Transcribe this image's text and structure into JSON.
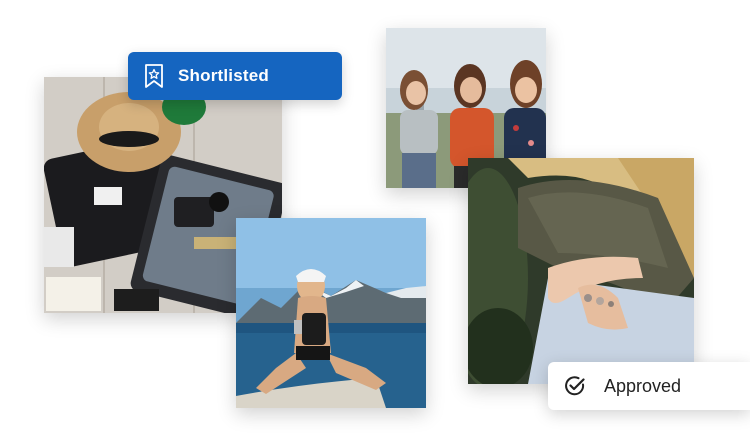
{
  "badges": {
    "shortlisted": {
      "label": "Shortlisted",
      "icon": "bookmark-star-icon",
      "color": "#1565c0"
    },
    "approved": {
      "label": "Approved",
      "icon": "check-circle-icon",
      "color": "#ffffff"
    }
  },
  "photos": [
    {
      "name": "photo-suitcase",
      "subject": "open suitcase with sun hat"
    },
    {
      "name": "photo-friends",
      "subject": "three friends laughing"
    },
    {
      "name": "photo-paddle",
      "subject": "woman on paddleboard on lake"
    },
    {
      "name": "photo-hands",
      "subject": "crossed hands with rings"
    }
  ]
}
